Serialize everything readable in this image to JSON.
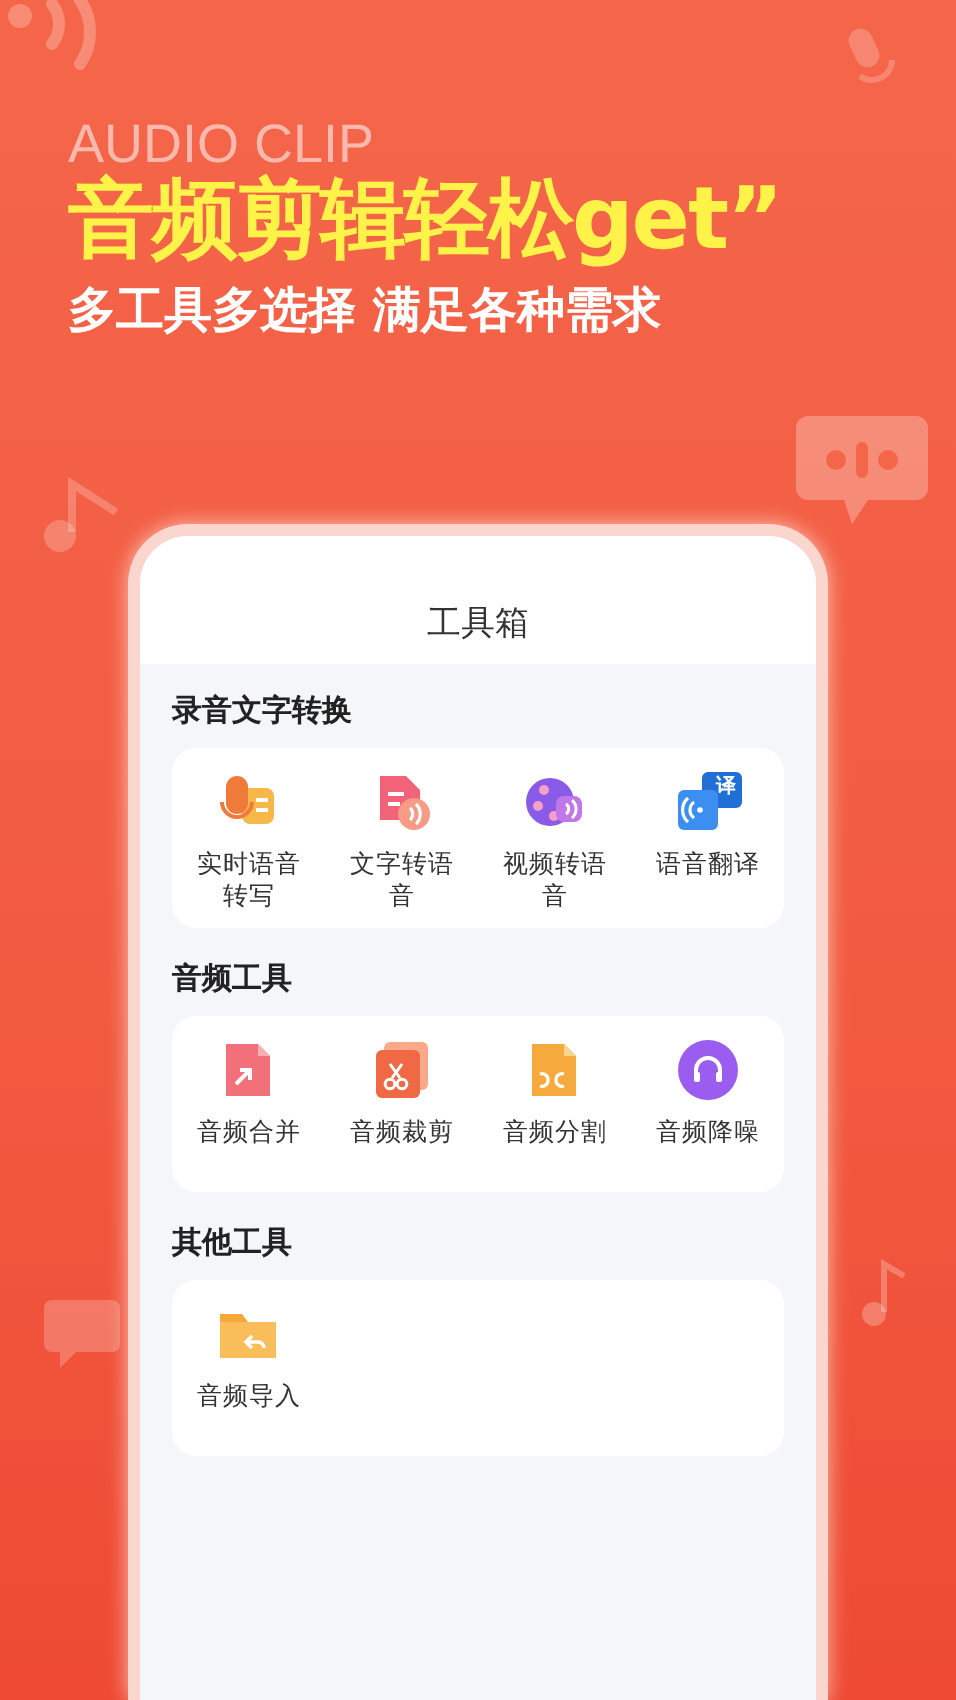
{
  "banner": {
    "watermark": "AUDIO CLIP",
    "headline": "音频剪辑轻松get”",
    "subtitle": "多工具多选择 满足各种需求"
  },
  "screen": {
    "title": "工具箱",
    "sections": [
      {
        "title": "录音文字转换",
        "tools": [
          {
            "label": "实时语音转写",
            "kind": "mic"
          },
          {
            "label": "文字转语音",
            "kind": "text"
          },
          {
            "label": "视频转语音",
            "kind": "video"
          },
          {
            "label": "语音翻译",
            "kind": "translate",
            "badge": "译"
          }
        ]
      },
      {
        "title": "音频工具",
        "tools": [
          {
            "label": "音频合并",
            "kind": "merge"
          },
          {
            "label": "音频裁剪",
            "kind": "cut"
          },
          {
            "label": "音频分割",
            "kind": "split"
          },
          {
            "label": "音频降噪",
            "kind": "denoise"
          }
        ]
      },
      {
        "title": "其他工具",
        "tools": [
          {
            "label": "音频导入",
            "kind": "import"
          }
        ]
      }
    ]
  }
}
